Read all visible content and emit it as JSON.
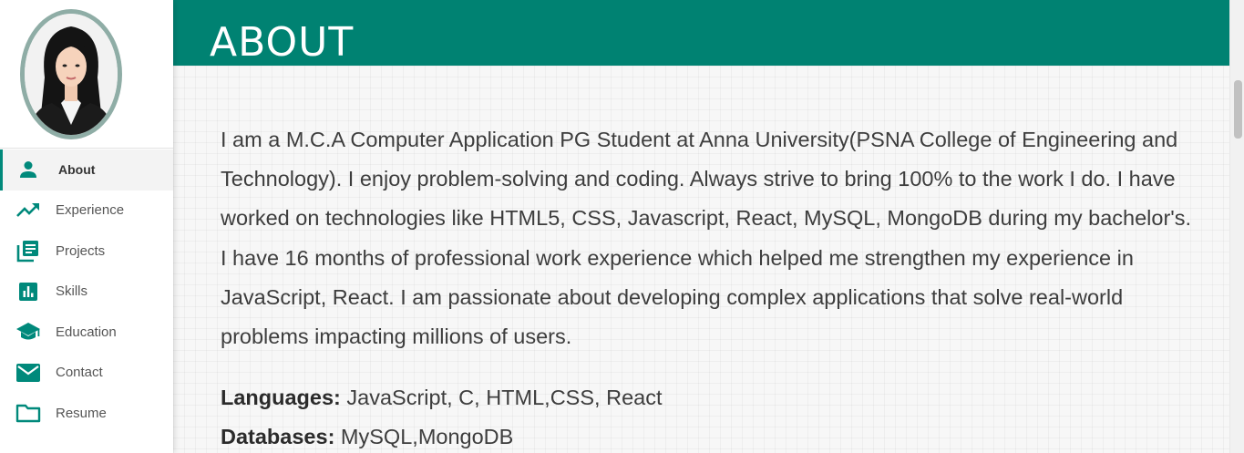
{
  "sidebar": {
    "items": [
      {
        "label": "About",
        "icon": "person-icon",
        "active": true
      },
      {
        "label": "Experience",
        "icon": "trending-up-icon",
        "active": false
      },
      {
        "label": "Projects",
        "icon": "library-books-icon",
        "active": false
      },
      {
        "label": "Skills",
        "icon": "bar-chart-icon",
        "active": false
      },
      {
        "label": "Education",
        "icon": "graduation-cap-icon",
        "active": false
      },
      {
        "label": "Contact",
        "icon": "mail-icon",
        "active": false
      },
      {
        "label": "Resume",
        "icon": "folder-icon",
        "active": false
      }
    ]
  },
  "header": {
    "title": "ABOUT"
  },
  "about": {
    "paragraph": "I am a M.C.A Computer Application PG Student at Anna University(PSNA College of Engineering and Technology). I enjoy problem-solving and coding. Always strive to bring 100% to the work I do. I have worked on technologies like HTML5, CSS, Javascript, React, MySQL, MongoDB during my bachelor's. I have 16 months of professional work experience which helped me strengthen my experience in JavaScript, React. I am passionate about developing complex applications that solve real-world problems impacting millions of users.",
    "languages_label": "Languages:",
    "languages_value": " JavaScript, C, HTML,CSS, React",
    "databases_label": "Databases:",
    "databases_value": " MySQL,MongoDB"
  },
  "colors": {
    "accent": "#008272",
    "icon": "#00897b"
  }
}
